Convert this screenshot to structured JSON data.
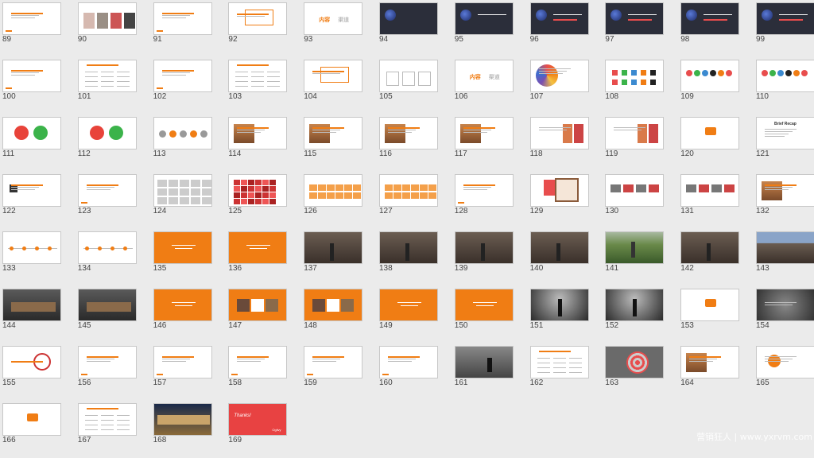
{
  "colors": {
    "background": "#ebebeb",
    "accent": "#f07d14",
    "red": "#e84d4d",
    "dark": "#3a3a3a",
    "photo": "#7a6a5a",
    "pale": "#ffffff"
  },
  "watermark": "营销狂人 | www.yxrvm.com",
  "slides": [
    {
      "n": "89",
      "kind": "text-red"
    },
    {
      "n": "90",
      "kind": "photos"
    },
    {
      "n": "91",
      "kind": "text"
    },
    {
      "n": "92",
      "kind": "text-box"
    },
    {
      "n": "93",
      "kind": "words",
      "words": [
        "内容",
        "渠道"
      ]
    },
    {
      "n": "94",
      "kind": "dark-planet"
    },
    {
      "n": "95",
      "kind": "dark-planet"
    },
    {
      "n": "96",
      "kind": "dark-planet"
    },
    {
      "n": "97",
      "kind": "dark-planet"
    },
    {
      "n": "98",
      "kind": "dark-planet"
    },
    {
      "n": "99",
      "kind": "dark-planet"
    },
    {
      "n": "100",
      "kind": "text"
    },
    {
      "n": "101",
      "kind": "table"
    },
    {
      "n": "102",
      "kind": "text"
    },
    {
      "n": "103",
      "kind": "table"
    },
    {
      "n": "104",
      "kind": "text-box"
    },
    {
      "n": "105",
      "kind": "diagram"
    },
    {
      "n": "106",
      "kind": "words",
      "words": [
        "内容",
        "渠道"
      ]
    },
    {
      "n": "107",
      "kind": "wheel"
    },
    {
      "n": "108",
      "kind": "icons"
    },
    {
      "n": "109",
      "kind": "icons-row"
    },
    {
      "n": "110",
      "kind": "icons-row"
    },
    {
      "n": "111",
      "kind": "weibo"
    },
    {
      "n": "112",
      "kind": "weibo"
    },
    {
      "n": "113",
      "kind": "flow"
    },
    {
      "n": "114",
      "kind": "photo-text"
    },
    {
      "n": "115",
      "kind": "photo-text"
    },
    {
      "n": "116",
      "kind": "photo-text"
    },
    {
      "n": "117",
      "kind": "photo-text"
    },
    {
      "n": "118",
      "kind": "people"
    },
    {
      "n": "119",
      "kind": "people"
    },
    {
      "n": "120",
      "kind": "logo"
    },
    {
      "n": "121",
      "kind": "recap",
      "title": "Brief Recap"
    },
    {
      "n": "122",
      "kind": "text-icon"
    },
    {
      "n": "123",
      "kind": "text"
    },
    {
      "n": "124",
      "kind": "gray-grid"
    },
    {
      "n": "125",
      "kind": "red-grid"
    },
    {
      "n": "126",
      "kind": "orange-grid"
    },
    {
      "n": "127",
      "kind": "orange-grid"
    },
    {
      "n": "128",
      "kind": "text"
    },
    {
      "n": "129",
      "kind": "collage"
    },
    {
      "n": "130",
      "kind": "cards"
    },
    {
      "n": "131",
      "kind": "cards"
    },
    {
      "n": "132",
      "kind": "photo-text"
    },
    {
      "n": "133",
      "kind": "timeline"
    },
    {
      "n": "134",
      "kind": "timeline"
    },
    {
      "n": "135",
      "kind": "orange"
    },
    {
      "n": "136",
      "kind": "orange"
    },
    {
      "n": "137",
      "kind": "street"
    },
    {
      "n": "138",
      "kind": "street"
    },
    {
      "n": "139",
      "kind": "street"
    },
    {
      "n": "140",
      "kind": "street"
    },
    {
      "n": "141",
      "kind": "field"
    },
    {
      "n": "142",
      "kind": "street"
    },
    {
      "n": "143",
      "kind": "street-sky"
    },
    {
      "n": "144",
      "kind": "station"
    },
    {
      "n": "145",
      "kind": "station"
    },
    {
      "n": "146",
      "kind": "orange"
    },
    {
      "n": "147",
      "kind": "orange-photos"
    },
    {
      "n": "148",
      "kind": "orange-photos"
    },
    {
      "n": "149",
      "kind": "orange"
    },
    {
      "n": "150",
      "kind": "orange"
    },
    {
      "n": "151",
      "kind": "dark-room"
    },
    {
      "n": "152",
      "kind": "dark-room"
    },
    {
      "n": "153",
      "kind": "logo"
    },
    {
      "n": "154",
      "kind": "spiral"
    },
    {
      "n": "155",
      "kind": "stamp"
    },
    {
      "n": "156",
      "kind": "text"
    },
    {
      "n": "157",
      "kind": "text"
    },
    {
      "n": "158",
      "kind": "text"
    },
    {
      "n": "159",
      "kind": "text"
    },
    {
      "n": "160",
      "kind": "text"
    },
    {
      "n": "161",
      "kind": "chess"
    },
    {
      "n": "162",
      "kind": "table"
    },
    {
      "n": "163",
      "kind": "target"
    },
    {
      "n": "164",
      "kind": "photo-text"
    },
    {
      "n": "165",
      "kind": "circle"
    },
    {
      "n": "166",
      "kind": "logo"
    },
    {
      "n": "167",
      "kind": "table"
    },
    {
      "n": "168",
      "kind": "night"
    },
    {
      "n": "169",
      "kind": "thanks",
      "title": "Thanks!",
      "sub": "Ogilvy"
    }
  ]
}
